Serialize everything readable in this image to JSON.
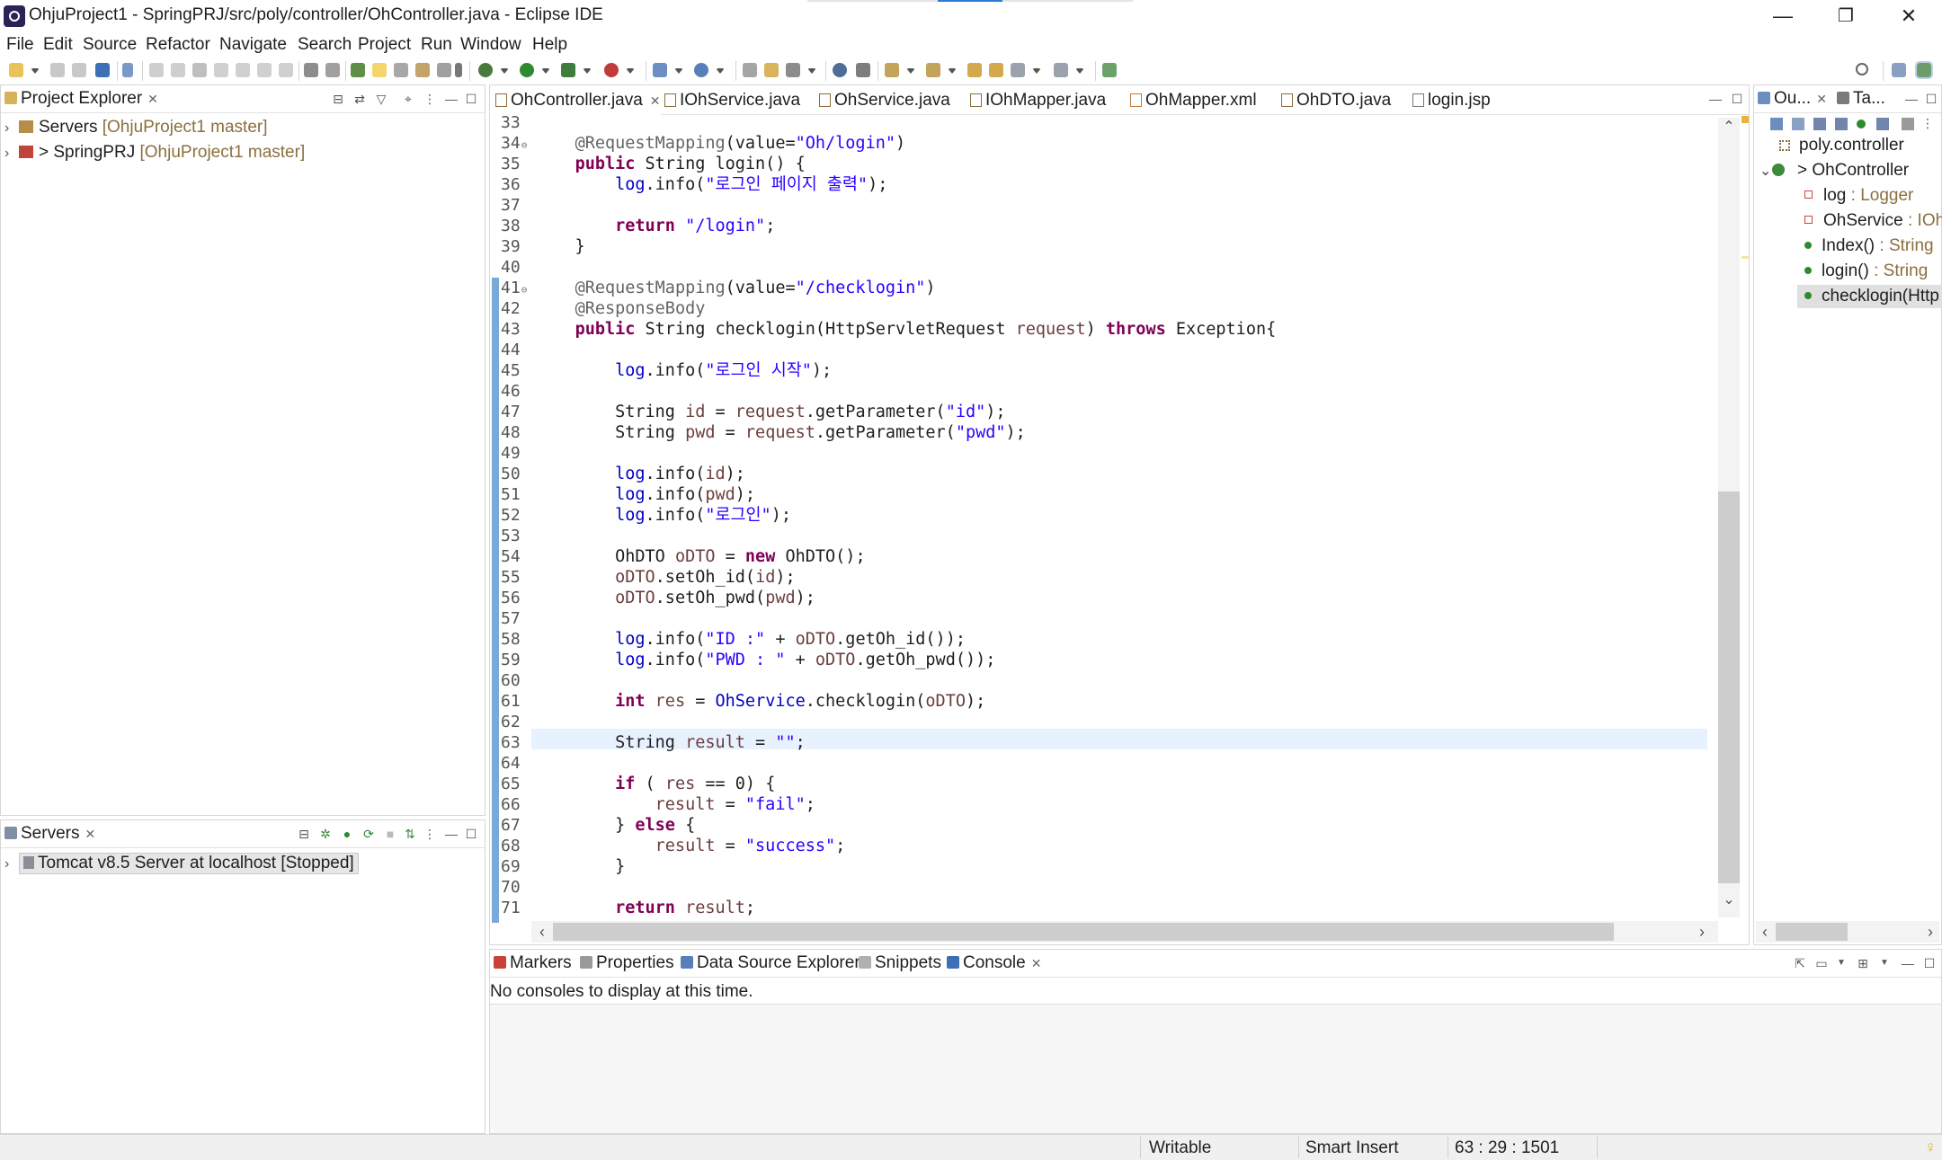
{
  "window": {
    "title": "OhjuProject1 - SpringPRJ/src/poly/controller/OhController.java - Eclipse IDE",
    "minimize": "—",
    "restore": "❐",
    "close": "✕"
  },
  "menu": [
    "File",
    "Edit",
    "Source",
    "Refactor",
    "Navigate",
    "Search",
    "Project",
    "Run",
    "Window",
    "Help"
  ],
  "project_explorer": {
    "tab_label": "Project Explorer",
    "items": [
      {
        "name": "Servers",
        "git": "[OhjuProject1 master]"
      },
      {
        "name": "> SpringPRJ",
        "git": "[OhjuProject1 master]"
      }
    ]
  },
  "servers_view": {
    "tab_label": "Servers",
    "items": [
      {
        "label": "Tomcat v8.5 Server at localhost  [Stopped]"
      }
    ]
  },
  "editor": {
    "tabs": [
      "OhController.java",
      "IOhService.java",
      "OhService.java",
      "IOhMapper.java",
      "OhMapper.xml",
      "OhDTO.java",
      "login.jsp"
    ],
    "active_tab": "OhController.java",
    "line_numbers": [
      "33",
      "34",
      "35",
      "36",
      "37",
      "38",
      "39",
      "40",
      "41",
      "42",
      "43",
      "44",
      "45",
      "46",
      "47",
      "48",
      "49",
      "50",
      "51",
      "52",
      "53",
      "54",
      "55",
      "56",
      "57",
      "58",
      "59",
      "60",
      "61",
      "62",
      "63",
      "64",
      "65",
      "66",
      "67",
      "68",
      "69",
      "70",
      "71"
    ],
    "highlighted_line": "63"
  },
  "outline": {
    "tab_label": "Ou...",
    "tab2_label": "Ta...",
    "items": [
      {
        "label": "poly.controller",
        "type": ""
      },
      {
        "label": "OhController",
        "type": ""
      },
      {
        "label": "log",
        "type": " : Logger"
      },
      {
        "label": "OhService",
        "type": " : IOh!"
      },
      {
        "label": "Index()",
        "type": " : String"
      },
      {
        "label": "login()",
        "type": " : String"
      },
      {
        "label": "checklogin(Http",
        "type": ""
      }
    ]
  },
  "bottom_panel": {
    "tabs": [
      "Markers",
      "Properties",
      "Data Source Explorer",
      "Snippets",
      "Console"
    ],
    "active_tab": "Console",
    "message": "No consoles to display at this time."
  },
  "status": {
    "mode": "Writable",
    "insert": "Smart Insert",
    "position": "63 : 29 : 1501"
  },
  "colors": {
    "keyword": "#7f0055",
    "string": "#2a00ff",
    "annotation": "#646464",
    "field": "#0000c0",
    "current_line": "#e8f2fe",
    "change_bar": "#7aa8d8"
  }
}
